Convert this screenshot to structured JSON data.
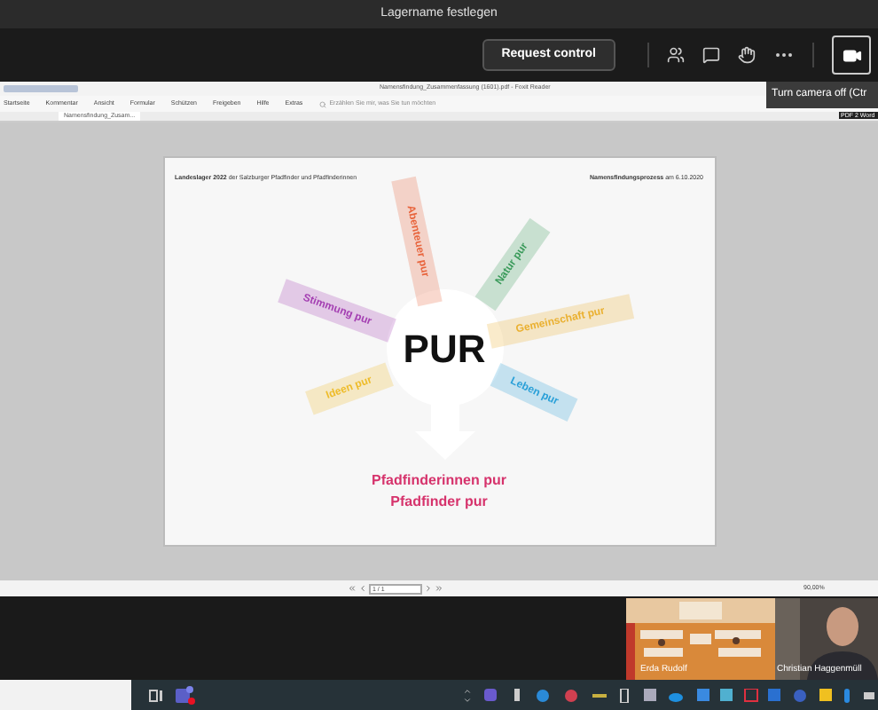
{
  "meeting": {
    "title": "Lagername festlegen",
    "request_button": "Request control",
    "tooltip": "Turn camera off (Ctr",
    "camera_on": true
  },
  "reader": {
    "window_title": "Namensfindung_Zusammenfassung (1601).pdf - Foxit Reader",
    "menu": [
      "Startseite",
      "Kommentar",
      "Ansicht",
      "Formular",
      "Schützen",
      "Freigeben",
      "Hilfe",
      "Extras"
    ],
    "search_hint": "Erzählen Sie mir, was Sie tun möchten",
    "doc_tab": "Namensfindung_Zusam...",
    "side_panel": "PDF 2 Word",
    "slide": {
      "header_left": "**Landeslager 2022** der Salzburger Pfadfinder und Pfadfinderinnen",
      "header_right": "**Namensfindungsprozess** am 6.10.2020",
      "center": "PUR",
      "words": [
        {
          "text": "Abenteuer pur",
          "color": "#e8643c"
        },
        {
          "text": "Natur pur",
          "color": "#3a9a5a"
        },
        {
          "text": "Stimmung pur",
          "color": "#a43fb2"
        },
        {
          "text": "Gemeinschaft pur",
          "color": "#eab030"
        },
        {
          "text": "Ideen pur",
          "color": "#eebc2a"
        },
        {
          "text": "Leben pur",
          "color": "#2aa0d8"
        }
      ],
      "result": [
        "Pfadfinderinnen pur",
        "Pfadfinder pur"
      ]
    },
    "page_field": "1 / 1",
    "zoom": "90,00%"
  },
  "participants": [
    {
      "name": "Erda Rudolf",
      "kind": "room"
    },
    {
      "name": "Christian Haggenmüll",
      "kind": "person"
    }
  ]
}
